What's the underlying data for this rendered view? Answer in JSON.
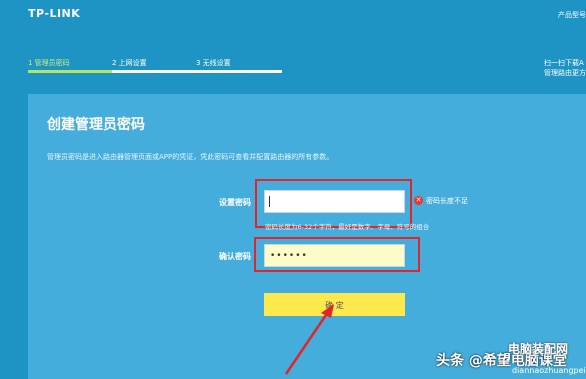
{
  "header": {
    "logo": "TP-LINK",
    "product_model": "产品型号"
  },
  "steps": [
    {
      "label": "1 管理员密码",
      "active": true
    },
    {
      "label": "2 上网设置",
      "active": false
    },
    {
      "label": "3 无线设置",
      "active": false
    }
  ],
  "qr": {
    "line1": "扫一扫下载A",
    "line2": "管理路由更方"
  },
  "panel": {
    "title": "创建管理员密码",
    "description": "管理员密码是进入路由器管理页面或APP的凭证，凭此密码可查看并配置路由器的所有参数。"
  },
  "form": {
    "password_label": "设置密码",
    "password_value": "",
    "password_error": "密码长度不足",
    "password_hint": "密码长度为6-32个字符，最好是数字、字母、符号的组合",
    "confirm_label": "确认密码",
    "confirm_value": "••••••",
    "submit_label": "确 定"
  },
  "watermark": {
    "toutiao": "头条 @希望电脑课堂",
    "site": "电脑装配网",
    "url": "diannaozhuangpei.com"
  },
  "colors": {
    "background": "#1e94c4",
    "panel": "#44addc",
    "button": "#fde84e",
    "highlight": "#e5232a",
    "active_step": "#b8e35a"
  }
}
